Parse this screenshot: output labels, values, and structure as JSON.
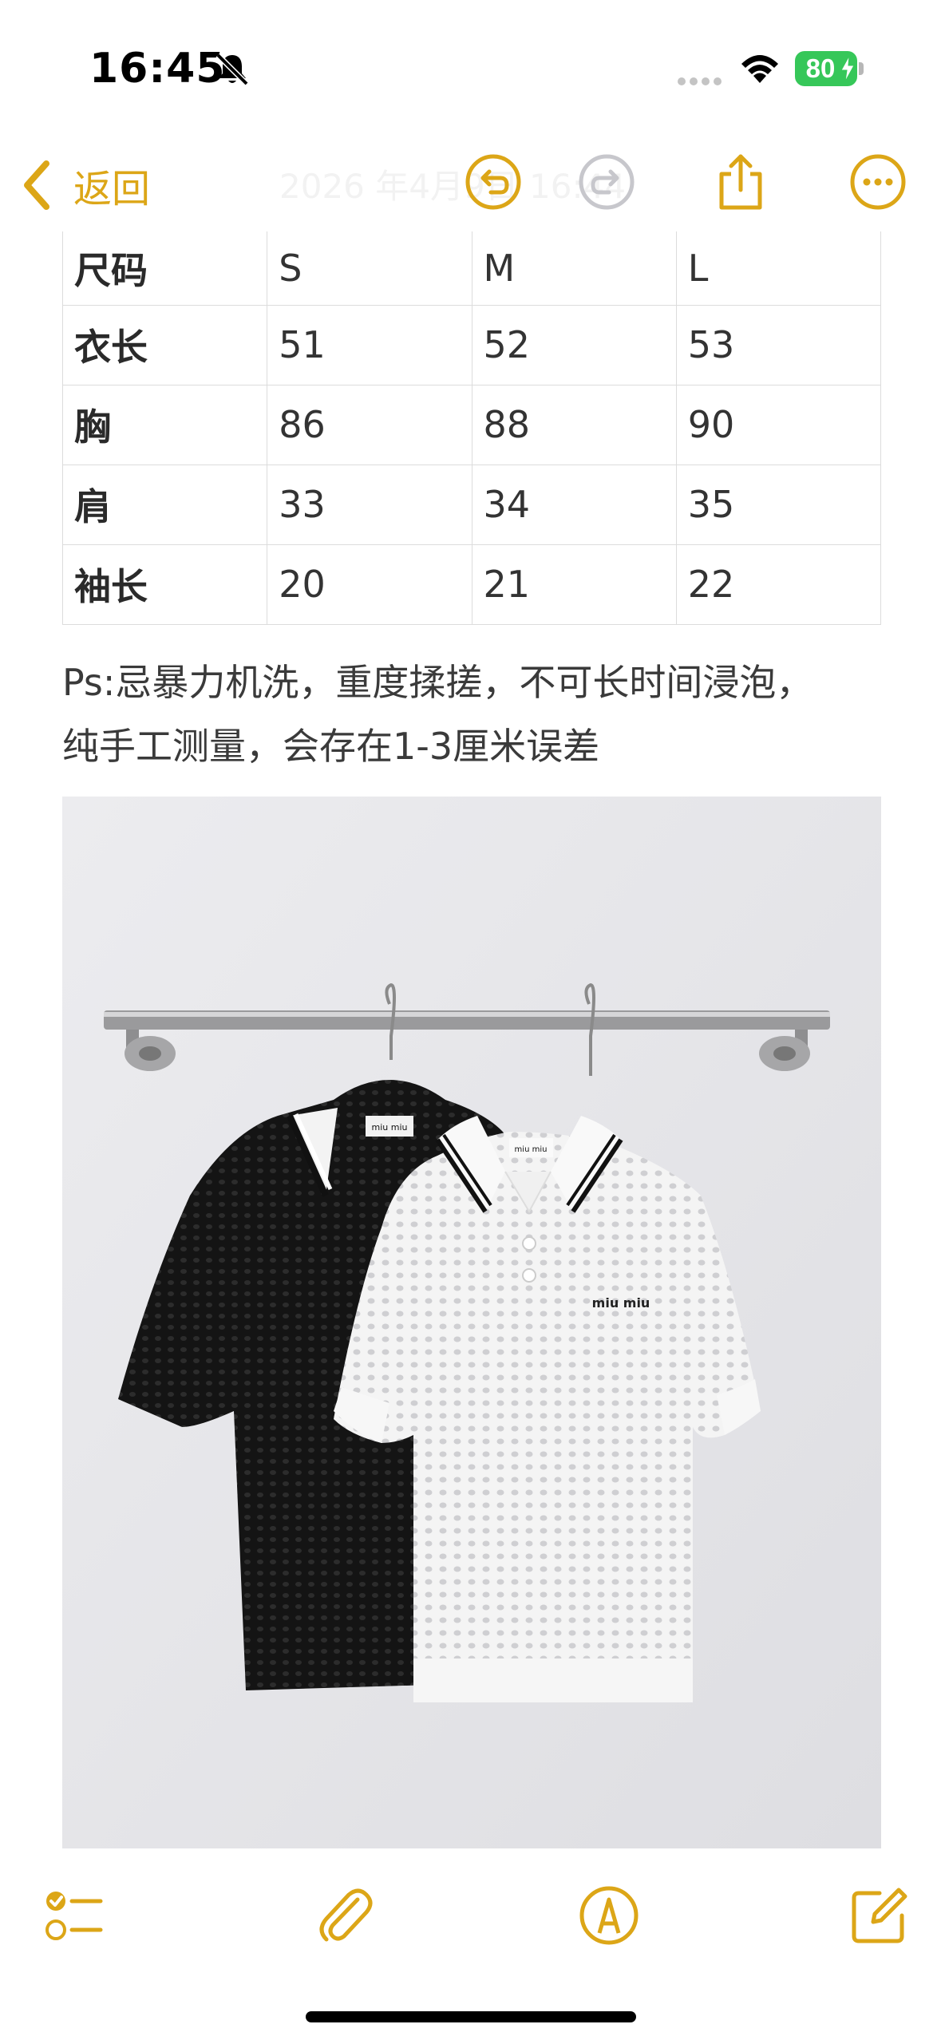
{
  "status_bar": {
    "time": "16:45",
    "battery": "80",
    "icons": [
      "bell-slash-icon",
      "signal-icon",
      "wifi-icon",
      "battery-charging-icon"
    ]
  },
  "nav": {
    "back_label": "返回",
    "title": "2026 年4月9日 16:44",
    "icons": [
      "chevron-left-icon",
      "undo-icon",
      "redo-icon",
      "share-icon",
      "more-icon"
    ]
  },
  "size_table": {
    "rows": [
      [
        "尺码",
        "S",
        "M",
        "L"
      ],
      [
        "衣长",
        "51",
        "52",
        "53"
      ],
      [
        "胸",
        "86",
        "88",
        "90"
      ],
      [
        "肩",
        "33",
        "34",
        "35"
      ],
      [
        "袖长",
        "20",
        "21",
        "22"
      ]
    ]
  },
  "note": {
    "line1": "Ps:忌暴力机洗，重度揉搓，不可长时间浸泡，",
    "line2": "纯手工测量，会存在1-3厘米误差"
  },
  "photo": {
    "logo_text": "miu miu",
    "description_icons": [
      "clothes-rack-icon",
      "black-polo-icon",
      "white-polo-icon"
    ]
  },
  "toolbar": {
    "icons": [
      "checklist-icon",
      "paperclip-icon",
      "markup-pen-icon",
      "compose-icon"
    ]
  },
  "colors": {
    "accent": "#dca617",
    "battery": "#36c759",
    "disabled": "#c7c7cc"
  }
}
